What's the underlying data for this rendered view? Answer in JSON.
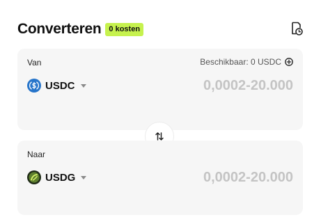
{
  "header": {
    "title": "Converteren",
    "badge": "0 kosten"
  },
  "from_card": {
    "label": "Van",
    "available": "Beschikbaar: 0 USDC",
    "token": {
      "symbol": "USDC",
      "icon": "usdc-coin-icon",
      "color": "#2775ca"
    },
    "amount_placeholder": "0,0002-20.000"
  },
  "to_card": {
    "label": "Naar",
    "token": {
      "symbol": "USDG",
      "icon": "usdg-coin-icon",
      "color": "#3a5a2a"
    },
    "amount_placeholder": "0,0002-20.000"
  },
  "colors": {
    "badge_bg": "#c6f24e",
    "card_bg": "#f6f6f6",
    "placeholder": "#c4c4c4"
  }
}
